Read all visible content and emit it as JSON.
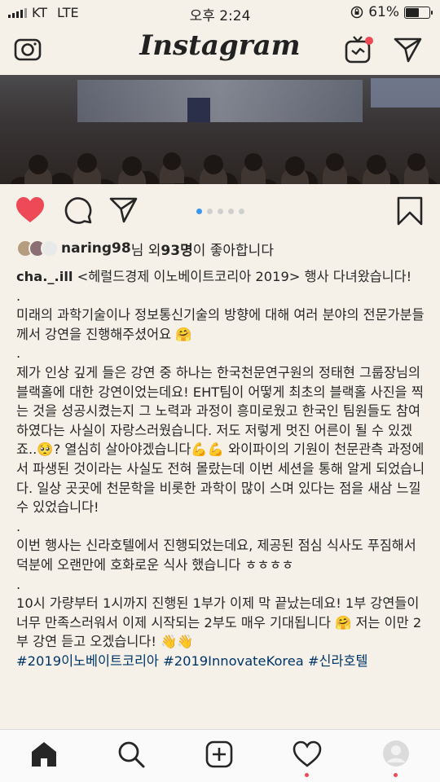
{
  "status_bar": {
    "carrier": "KT",
    "network": "LTE",
    "time": "오후 2:24",
    "battery_percent_label": "61%",
    "battery_level": 0.61
  },
  "header": {
    "logo": "Instagram",
    "icons": [
      "camera-icon",
      "igtv-icon",
      "direct-message-icon"
    ],
    "igtv_badge_color": "#ed4956"
  },
  "post": {
    "carousel": {
      "total": 5,
      "active": 1,
      "active_color": "#3897f0"
    },
    "likes": {
      "first_liker": "naring98",
      "suffix_1": "님 외 ",
      "count": "93명",
      "suffix_2": "이 좋아합니다"
    },
    "caption": {
      "username": "cha._.ill",
      "lines": [
        " <헤럴드경제 이노베이트코리아 2019> 행사 다녀왔습니다!",
        ".",
        "미래의 과학기술이나 정보통신기술의 방향에 대해 여러 분야의 전문가분들께서 강연을 진행해주셨어요 🤗",
        ".",
        "제가 인상 깊게 들은 강연 중 하나는 한국천문연구원의 정태현 그룹장님의 블랙홀에 대한 강연이었는데요! EHT팀이 어떻게 최초의 블랙홀 사진을 찍는 것을 성공시켰는지 그 노력과 과정이 흥미로웠고 한국인 팀원들도 참여하였다는 사실이 자랑스러웠습니다. 저도 저렇게 멋진 어른이 될 수 있겠죠..🥺? 열심히 살아야겠습니다💪💪 와이파이의 기원이 천문관측 과정에서 파생된 것이라는 사실도 전혀 몰랐는데 이번 세션을 통해 알게 되었습니다. 일상 곳곳에 천문학을 비롯한 과학이 많이 스며 있다는 점을 새삼 느낄 수 있었습니다!",
        ".",
        "이번 행사는 신라호텔에서 진행되었는데요, 제공된 점심 식사도 푸짐해서 덕분에 오랜만에 호화로운 식사 했습니다 ㅎㅎㅎㅎ",
        ".",
        "10시 가량부터 1시까지 진행된 1부가 이제 막 끝났는데요! 1부 강연들이 너무 만족스러워서 이제 시작되는 2부도 매우 기대됩니다 🤗 저는 이만 2부 강연 듣고 오겠습니다! 👋👋"
      ],
      "hashtags": "#2019이노베이트코리아 #2019InnovateKorea #신라호텔"
    }
  },
  "tab_bar": {
    "items": [
      "home-icon",
      "search-icon",
      "new-post-icon",
      "activity-icon",
      "profile-icon"
    ],
    "notification_color": "#ed4956"
  }
}
